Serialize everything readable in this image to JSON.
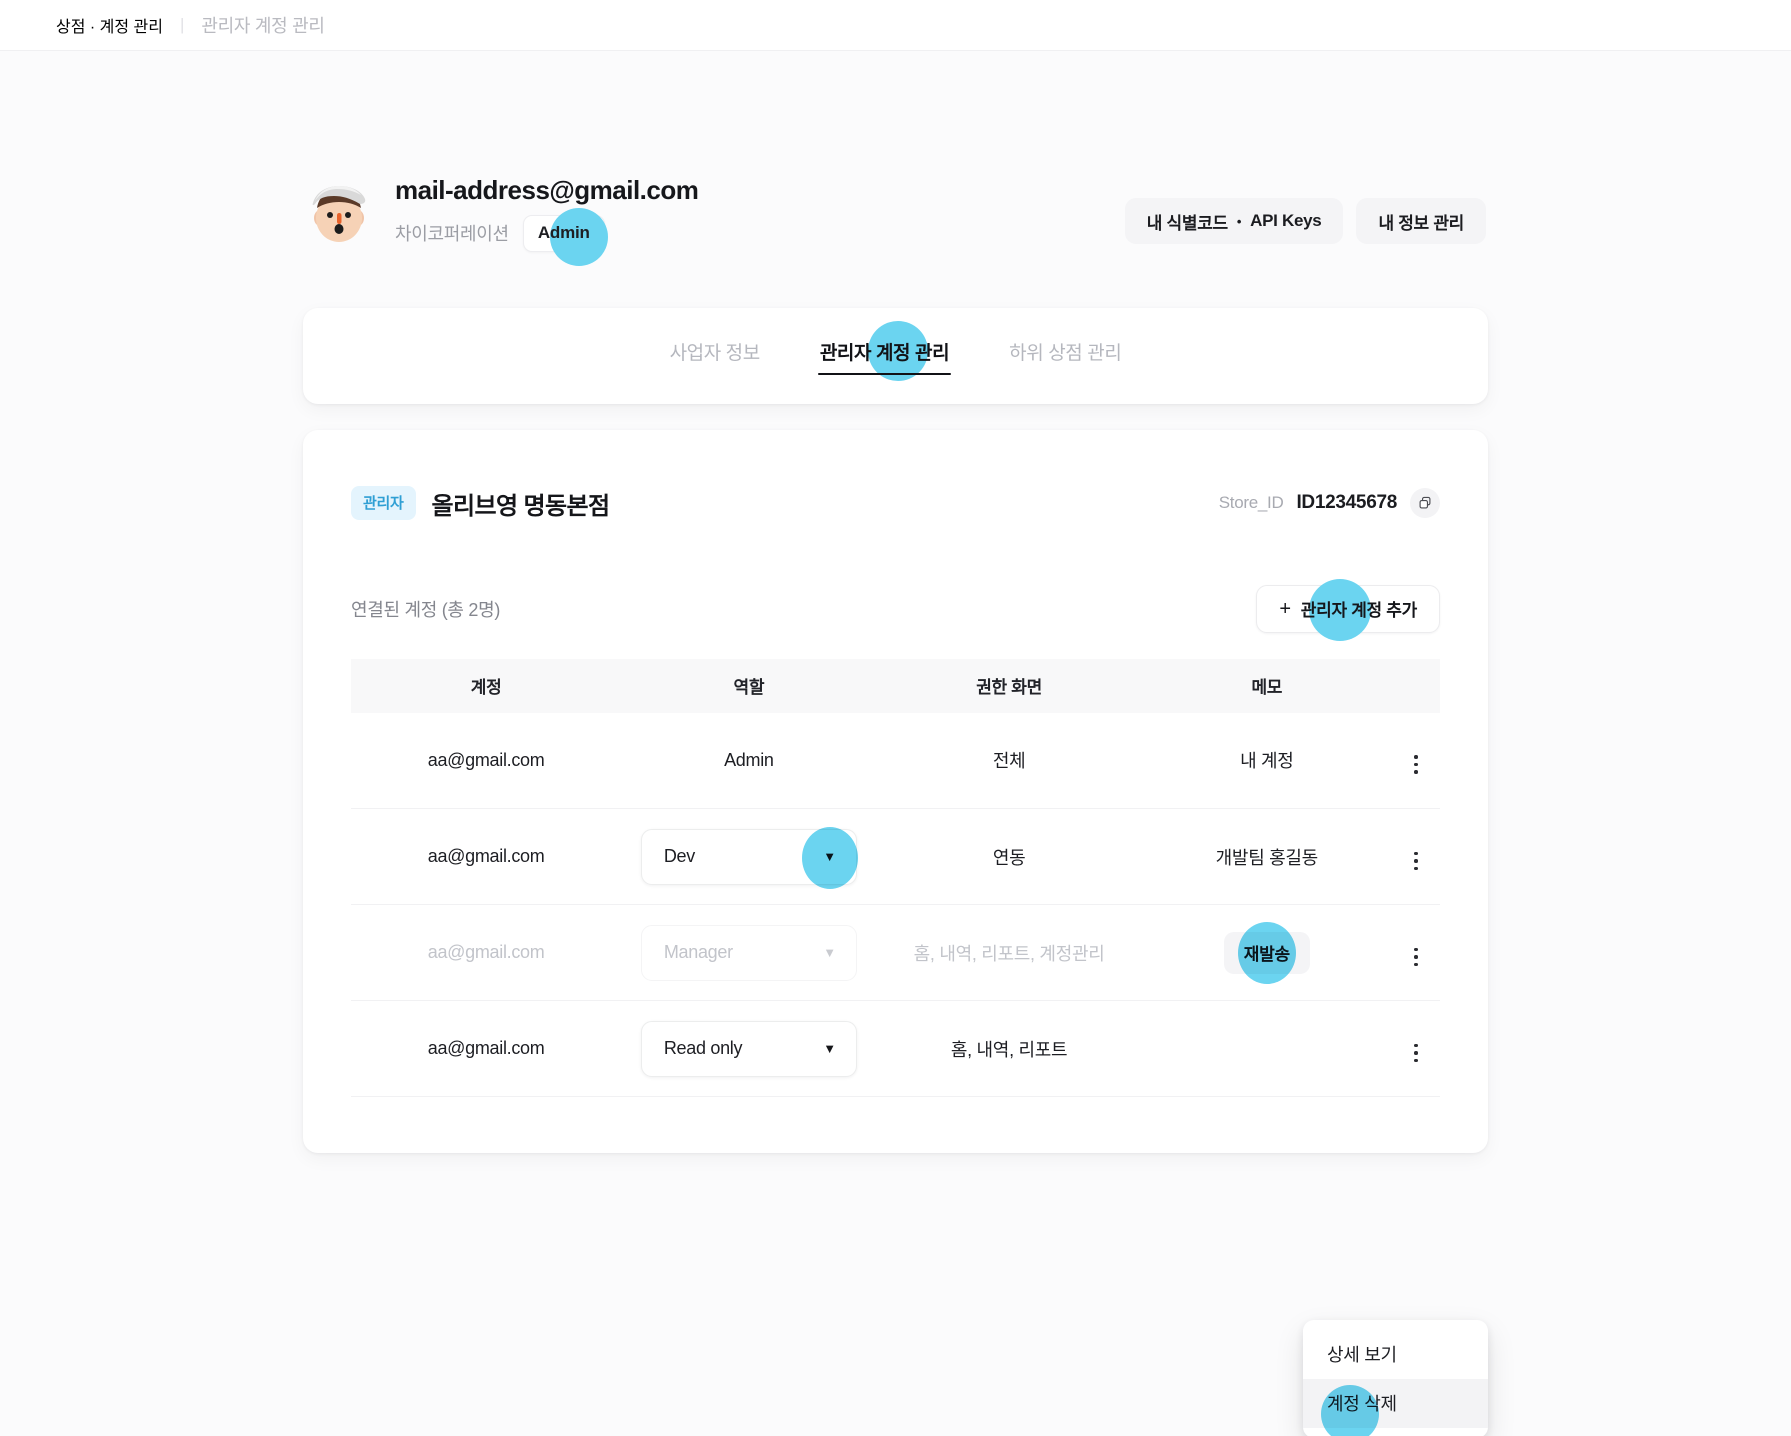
{
  "breadcrumb": {
    "main": "상점 · 계정 관리",
    "separator": "|",
    "current": "관리자 계정 관리"
  },
  "profile": {
    "email": "mail-address@gmail.com",
    "company": "차이코퍼레이션",
    "role_badge": "Admin",
    "avatar_icon": "person-with-cap-avatar"
  },
  "header_actions": {
    "identity_keys_label": "내 식별코드",
    "identity_keys_dot": "•",
    "identity_keys_suffix": "API Keys",
    "my_info_label": "내 정보 관리"
  },
  "tabs": [
    {
      "label": "사업자 정보",
      "active": false
    },
    {
      "label": "관리자 계정 관리",
      "active": true
    },
    {
      "label": "하위 상점 관리",
      "active": false
    }
  ],
  "store": {
    "badge": "관리자",
    "name": "올리브영 명동본점",
    "id_label": "Store_ID",
    "id_value": "ID12345678",
    "copy_icon": "copy-icon"
  },
  "accounts": {
    "count_label": "연결된 계정 (총 2명)",
    "add_button_plus": "+",
    "add_button_label": "관리자 계정 추가",
    "columns": [
      "계정",
      "역할",
      "권한 화면",
      "메모"
    ],
    "rows": [
      {
        "account": "aa@gmail.com",
        "role": "Admin",
        "role_is_select": false,
        "permission": "전체",
        "memo": "내 계정",
        "memo_is_button": false,
        "muted": false
      },
      {
        "account": "aa@gmail.com",
        "role": "Dev",
        "role_is_select": true,
        "permission": "연동",
        "memo": "개발팀 홍길동",
        "memo_is_button": false,
        "muted": false
      },
      {
        "account": "aa@gmail.com",
        "role": "Manager",
        "role_is_select": true,
        "permission": "홈, 내역, 리포트, 계정관리",
        "memo": "재발송",
        "memo_is_button": true,
        "muted": true
      },
      {
        "account": "aa@gmail.com",
        "role": "Read only",
        "role_is_select": true,
        "permission": "홈, 내역, 리포트",
        "memo": "",
        "memo_is_button": false,
        "muted": false
      }
    ],
    "kebab_icon": "vertical-dots-icon",
    "caret_icon": "chevron-down-icon"
  },
  "context_menu": {
    "items": [
      {
        "label": "상세 보기",
        "hovered": false
      },
      {
        "label": "계정 삭제",
        "hovered": true
      }
    ]
  },
  "colors": {
    "highlight": "#6bd4f0",
    "badge_bg": "#e4f4fd",
    "badge_text": "#2f9fd4",
    "page_bg": "#fbfbfc",
    "card_bg": "#ffffff",
    "text_primary": "#15161a",
    "text_muted": "#b5b7be"
  }
}
